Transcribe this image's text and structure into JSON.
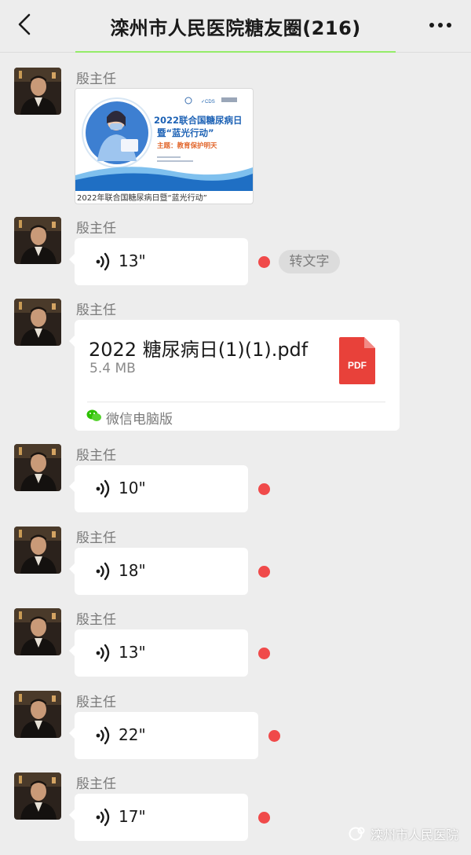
{
  "header": {
    "title": "滦州市人民医院糖友圈(216)"
  },
  "colors": {
    "background": "#ededed",
    "bubble": "#ffffff",
    "unread_dot": "#f04a4a",
    "pdf_red": "#e8413a",
    "accent_green": "#95ec69"
  },
  "messages": [
    {
      "type": "image",
      "sender": "殷主任",
      "image": {
        "title_line1": "2022联合国糖尿病日",
        "title_line2": "暨“蓝光行动”",
        "subtitle": "主题：教育保护明天",
        "caption": "2022年联合国糖尿病日暨“蓝光行动”"
      }
    },
    {
      "type": "voice",
      "sender": "殷主任",
      "duration": "13\"",
      "unread": true,
      "transcribe_label": "转文字"
    },
    {
      "type": "file",
      "sender": "殷主任",
      "file_name": "2022 糖尿病日(1)(1).pdf",
      "file_size": "5.4 MB",
      "file_icon_label": "PDF",
      "source": "微信电脑版"
    },
    {
      "type": "voice",
      "sender": "殷主任",
      "duration": "10\"",
      "unread": true
    },
    {
      "type": "voice",
      "sender": "殷主任",
      "duration": "18\"",
      "unread": true
    },
    {
      "type": "voice",
      "sender": "殷主任",
      "duration": "13\"",
      "unread": true
    },
    {
      "type": "voice",
      "sender": "殷主任",
      "duration": "22\"",
      "unread": true
    },
    {
      "type": "voice",
      "sender": "殷主任",
      "duration": "17\"",
      "unread": true
    }
  ],
  "watermark": "滦州市人民医院"
}
